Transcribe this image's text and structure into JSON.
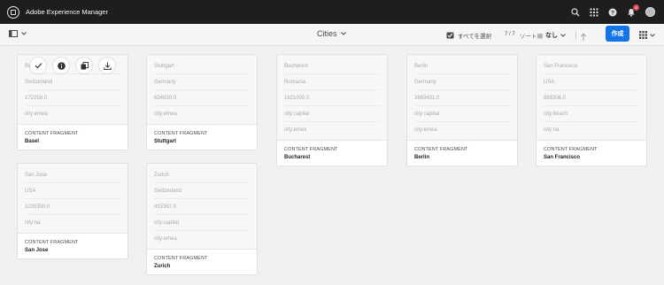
{
  "app": {
    "title": "Adobe Experience Manager",
    "notification_count": "4"
  },
  "toolbar": {
    "title": "Cities",
    "select_all": "すべてを選択",
    "count": "7 / 7",
    "sort_label": "ソート順",
    "sort_value": "なし",
    "create_label": "作成"
  },
  "cards": [
    {
      "lines": [
        "Basel",
        "Switzerland",
        "172258.0",
        "city:emea"
      ],
      "type": "CONTENT FRAGMENT",
      "name": "Basel"
    },
    {
      "lines": [
        "Stuttgart",
        "Germany",
        "634830.0",
        "city:emea"
      ],
      "type": "CONTENT FRAGMENT",
      "name": "Stuttgart"
    },
    {
      "lines": [
        "Bucharest",
        "Romania",
        "1821000.0",
        "city:capital",
        "city:emex"
      ],
      "type": "CONTENT FRAGMENT",
      "name": "Bucharest"
    },
    {
      "lines": [
        "Berlin",
        "Germany",
        "3669491.0",
        "city:capital",
        "city:emea"
      ],
      "type": "CONTENT FRAGMENT",
      "name": "Berlin"
    },
    {
      "lines": [
        "San Francisco",
        "USA",
        "883306.0",
        "city:beach",
        "city:na"
      ],
      "type": "CONTENT FRAGMENT",
      "name": "San Francisco"
    },
    {
      "lines": [
        "San Jose",
        "USA",
        "1026350.0",
        "city:na"
      ],
      "type": "CONTENT FRAGMENT",
      "name": "San Jose"
    },
    {
      "lines": [
        "Zurich",
        "Switzerland",
        "415367.0",
        "city:capital",
        "city:emea"
      ],
      "type": "CONTENT FRAGMENT",
      "name": "Zurich"
    }
  ],
  "colors": {
    "shell": "#1e1e1e",
    "accent": "#1473e6",
    "badge": "#e34850"
  },
  "icons": {
    "quick_actions": [
      "checkmark-icon",
      "info-icon",
      "copy-icon",
      "download-icon"
    ]
  }
}
